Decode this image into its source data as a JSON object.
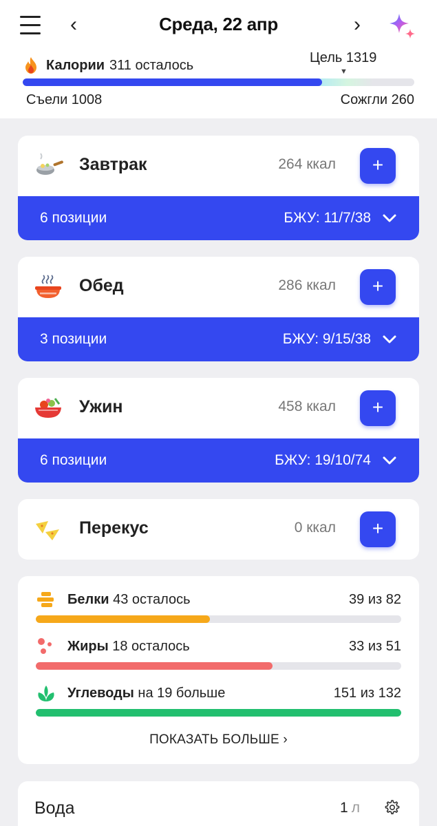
{
  "header": {
    "date": "Среда, 22 апр",
    "prev_arrow": "‹",
    "next_arrow": "›",
    "icons": [
      "menu-icon",
      "sparkles-icon",
      "fire-icon"
    ]
  },
  "calories": {
    "label": "Калории",
    "remaining": "311 осталось",
    "goal": "Цель 1319",
    "eaten": "Съели 1008",
    "burned": "Сожгли 260",
    "progress_fraction": 0.764
  },
  "meals": [
    {
      "name": "Завтрак",
      "kcal": "264 ккал",
      "add": "+",
      "items": "6 позиции",
      "macros": "БЖУ: 11/7/38",
      "icon": "breakfast-wok-icon"
    },
    {
      "name": "Обед",
      "kcal": "286 ккал",
      "add": "+",
      "items": "3 позиции",
      "macros": "БЖУ: 9/15/38",
      "icon": "lunch-soup-bowl-icon"
    },
    {
      "name": "Ужин",
      "kcal": "458 ккал",
      "add": "+",
      "items": "6 позиции",
      "macros": "БЖУ: 19/10/74",
      "icon": "dinner-salad-bowl-icon"
    },
    {
      "name": "Перекус",
      "kcal": "0 ккал",
      "add": "+",
      "icon": "snack-nachos-icon"
    }
  ],
  "macros": [
    {
      "name": "Белки",
      "status": "43 осталось",
      "value": "39 из 82",
      "fraction": 0.476,
      "color": "#f6a81a",
      "icon": "protein-icon"
    },
    {
      "name": "Жиры",
      "status": "18 осталось",
      "value": "33 из 51",
      "fraction": 0.647,
      "color": "#f26b6b",
      "icon": "fat-icon"
    },
    {
      "name": "Углеводы",
      "status": "на 19 больше",
      "value": "151 из 132",
      "fraction": 1.0,
      "color": "#22bf6f",
      "icon": "carbs-sprout-icon"
    }
  ],
  "show_more": "ПОКАЗАТЬ БОЛЬШЕ ›",
  "water": {
    "title": "Вода",
    "value": "1",
    "unit": "л",
    "icon": "gear-icon"
  },
  "colors": {
    "accent": "#3448f0",
    "background": "#efeff2"
  }
}
